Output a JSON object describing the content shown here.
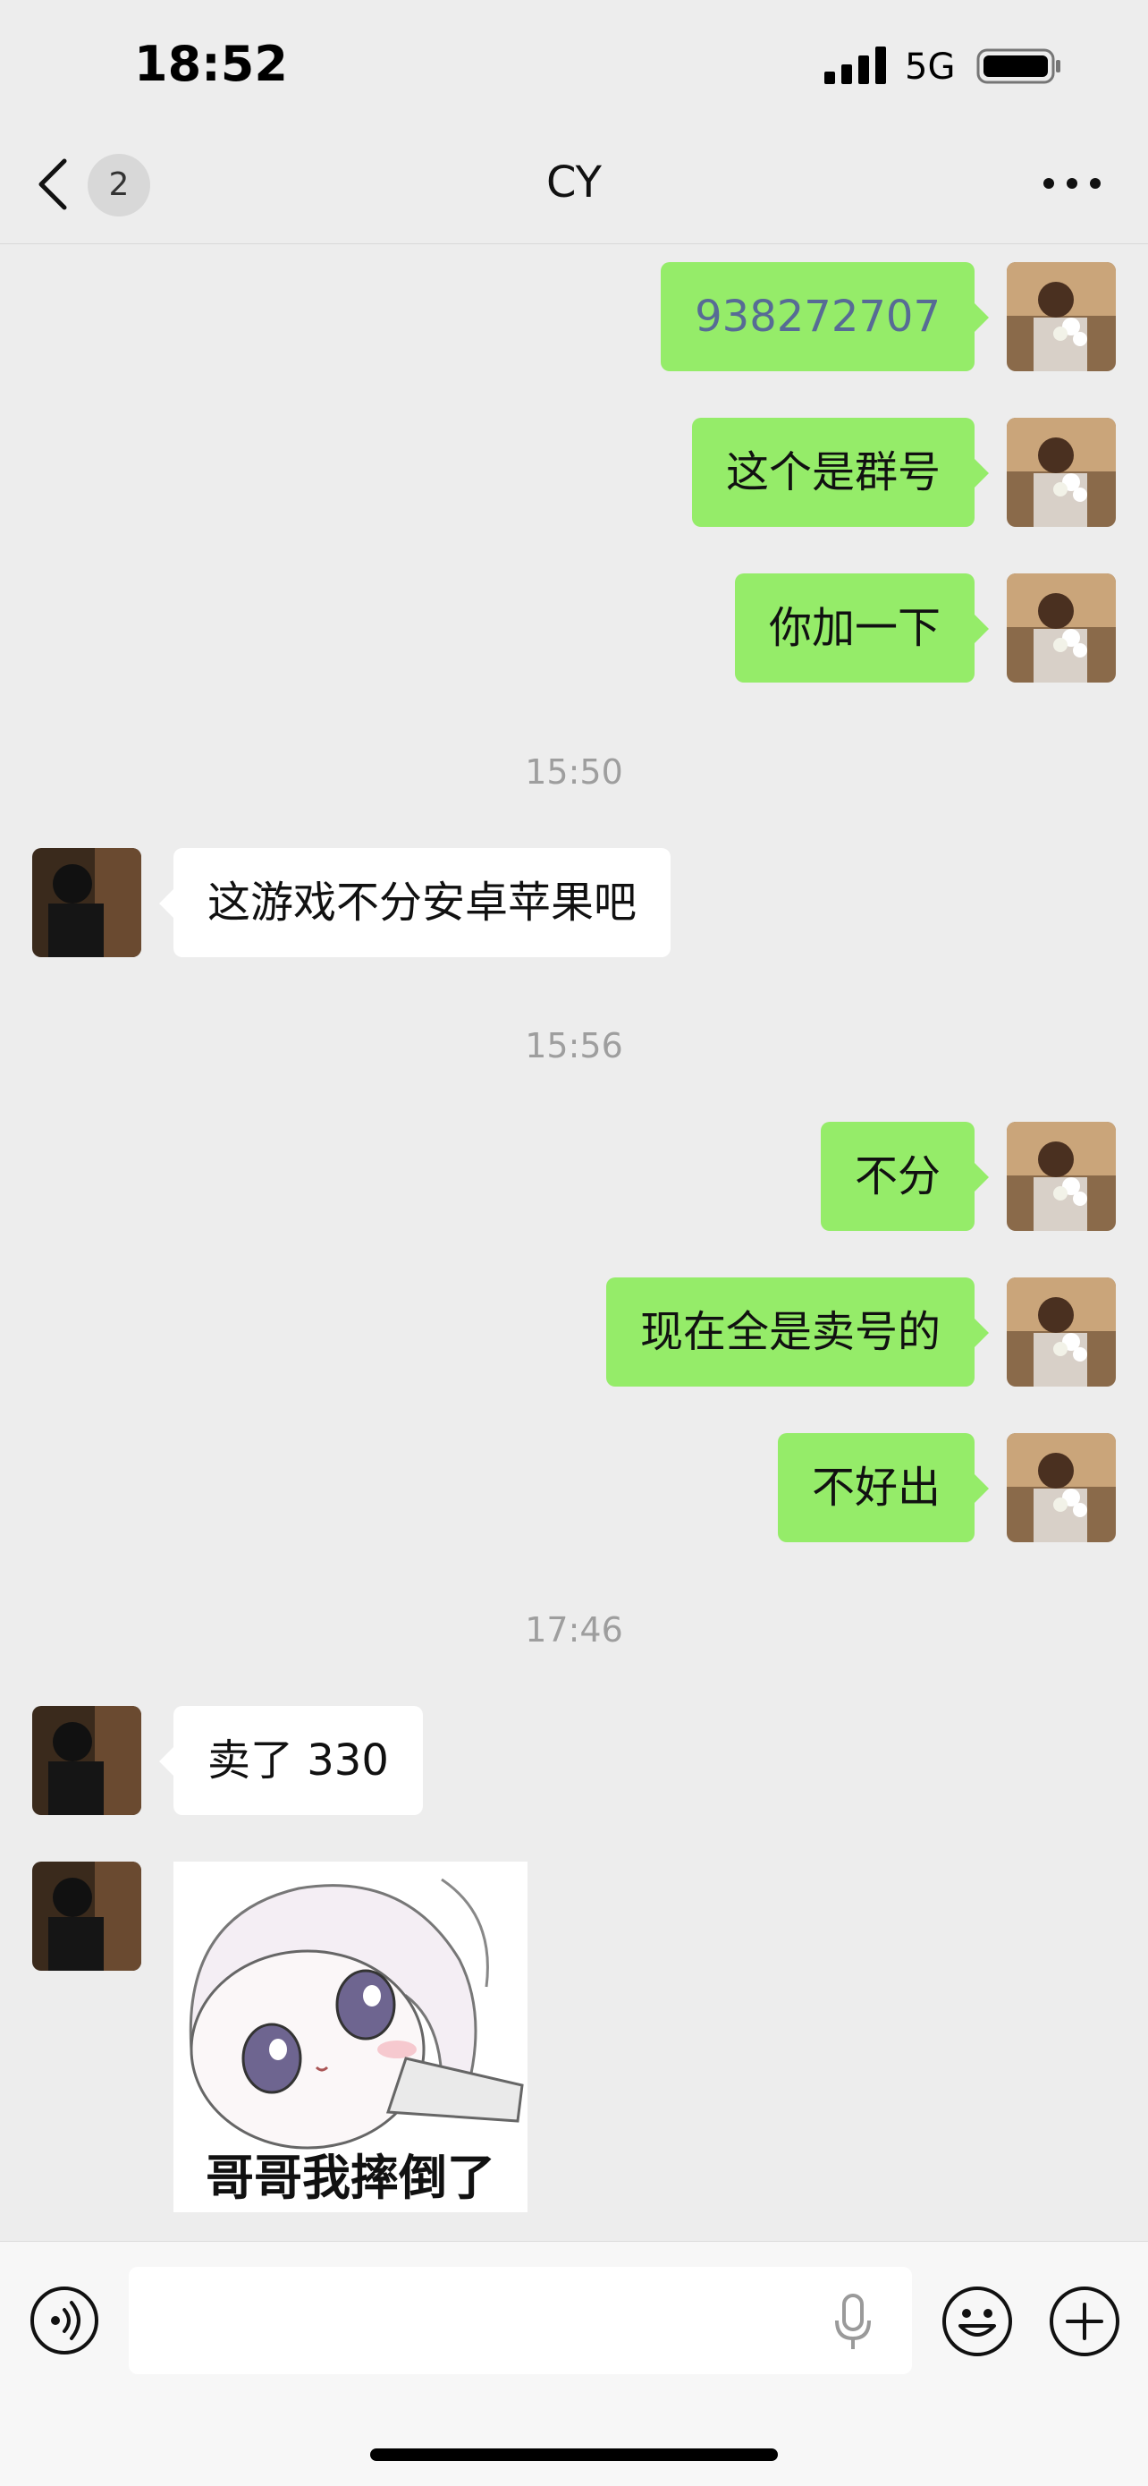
{
  "status_bar": {
    "time": "18:52",
    "network": "5G"
  },
  "nav": {
    "back_badge": "2",
    "title": "CY"
  },
  "messages": [
    {
      "sender": "me",
      "text": "938272707",
      "type": "link"
    },
    {
      "sender": "me",
      "text": "这个是群号"
    },
    {
      "sender": "me",
      "text": "你加一下"
    },
    {
      "timestamp": "15:50"
    },
    {
      "sender": "other",
      "text": "这游戏不分安卓苹果吧"
    },
    {
      "timestamp": "15:56"
    },
    {
      "sender": "me",
      "text": "不分"
    },
    {
      "sender": "me",
      "text": "现在全是卖号的"
    },
    {
      "sender": "me",
      "text": "不好出"
    },
    {
      "timestamp": "17:46"
    },
    {
      "sender": "other",
      "text": "卖了 330"
    },
    {
      "sender": "other",
      "type": "sticker",
      "caption": "哥哥我摔倒了"
    }
  ],
  "input": {
    "value": "",
    "placeholder": ""
  }
}
